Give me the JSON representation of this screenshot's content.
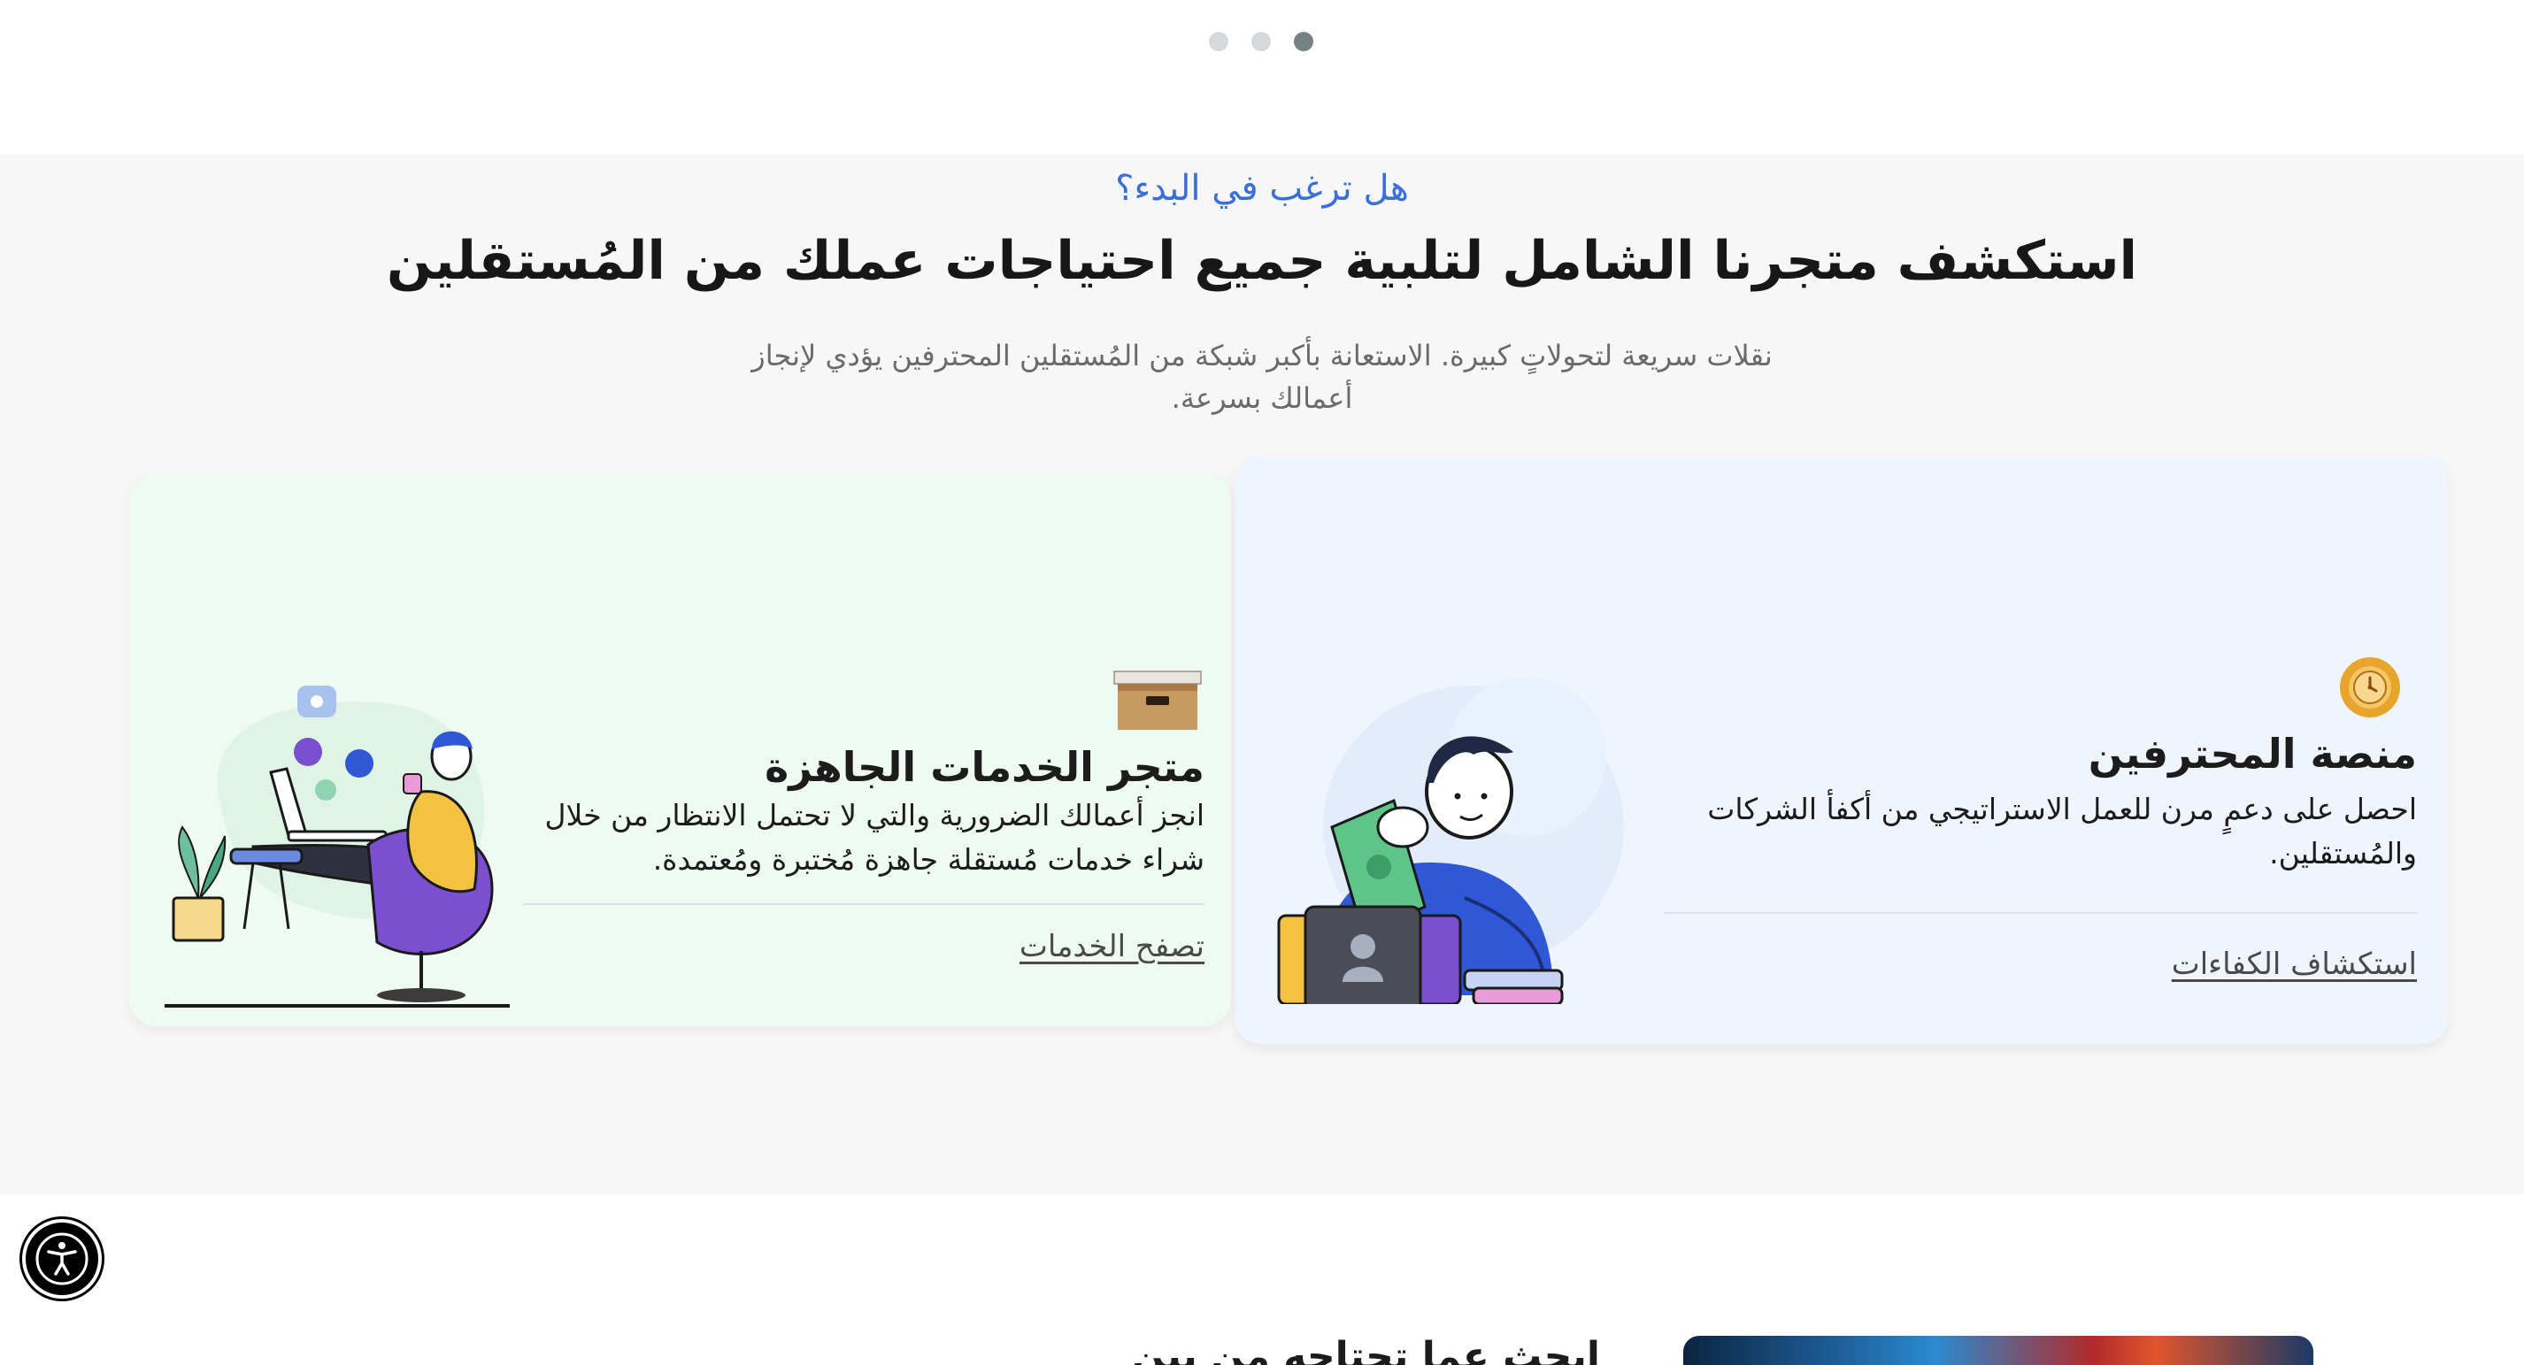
{
  "carousel": {
    "total": 3,
    "active_index": 2
  },
  "section": {
    "eyebrow": "هل ترغب في البدء؟",
    "headline": "استكشف متجرنا الشامل لتلبية جميع احتياجات عملك من المُستقلين",
    "subtext": "نقلات سريعة لتحولاتٍ كبيرة. الاستعانة بأكبر شبكة من المُستقلين المحترفين يؤدي لإنجاز أعمالك بسرعة."
  },
  "cards": {
    "professionals": {
      "icon": "clock-badge-icon",
      "title": "منصة المحترفين",
      "description": "احصل على دعمٍ مرن للعمل الاستراتيجي من أكفأ الشركات والمُستقلين.",
      "link": "استكشاف الكفاءات"
    },
    "services_store": {
      "icon": "box-icon",
      "title": "متجر الخدمات الجاهزة",
      "description": "انجز أعمالك الضرورية والتي لا تحتمل الانتظار من خلال شراء خدمات مُستقلة جاهزة مُختبرة ومُعتمدة.",
      "link": "تصفح الخدمات"
    }
  },
  "bottom": {
    "heading": "ابحث عما تحتاجه من بين"
  },
  "accessibility": {
    "icon": "accessibility-icon"
  },
  "colors": {
    "accent": "#3a6fd8",
    "band": "#f7f7f7",
    "pro_card": "#eff4fd",
    "store_card": "#eefaf2",
    "dot_active": "#758283",
    "dot_inactive": "#d6d8db"
  }
}
